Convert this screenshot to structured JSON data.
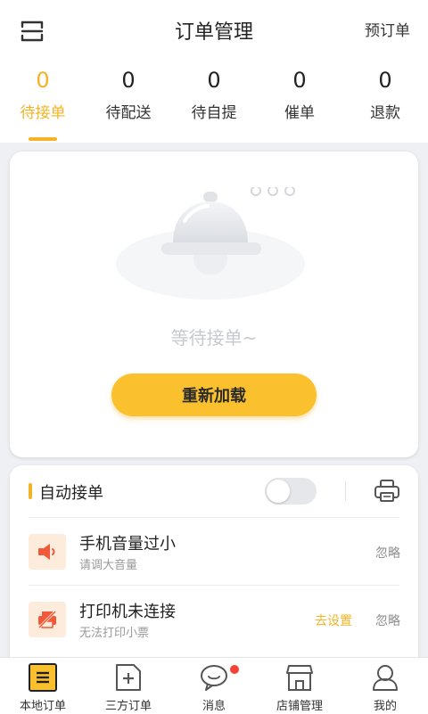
{
  "header": {
    "title": "订单管理",
    "preorder_label": "预订单"
  },
  "status_tabs": [
    {
      "count": "0",
      "label": "待接单",
      "active": true
    },
    {
      "count": "0",
      "label": "待配送",
      "active": false
    },
    {
      "count": "0",
      "label": "待自提",
      "active": false
    },
    {
      "count": "0",
      "label": "催单",
      "active": false
    },
    {
      "count": "0",
      "label": "退款",
      "active": false
    }
  ],
  "empty_state": {
    "message": "等待接单~",
    "reload_label": "重新加载"
  },
  "auto_accept": {
    "label": "自动接单",
    "enabled": false
  },
  "alerts": [
    {
      "title": "手机音量过小",
      "subtitle": "请调大音量",
      "ignore_label": "忽略",
      "icon": "speaker-icon"
    },
    {
      "title": "打印机未连接",
      "subtitle": "无法打印小票",
      "action_label": "去设置",
      "ignore_label": "忽略",
      "icon": "printer-off-icon"
    }
  ],
  "bottom_nav": [
    {
      "label": "本地订单",
      "icon": "local-orders-icon",
      "active": true
    },
    {
      "label": "三方订单",
      "icon": "third-party-orders-icon",
      "active": false
    },
    {
      "label": "消息",
      "icon": "message-icon",
      "active": false,
      "has_badge": true
    },
    {
      "label": "店铺管理",
      "icon": "store-icon",
      "active": false
    },
    {
      "label": "我的",
      "icon": "profile-icon",
      "active": false
    }
  ],
  "colors": {
    "accent": "#f4b324",
    "button": "#fbc02d",
    "alert_red": "#f05a3a",
    "badge": "#f44336"
  }
}
